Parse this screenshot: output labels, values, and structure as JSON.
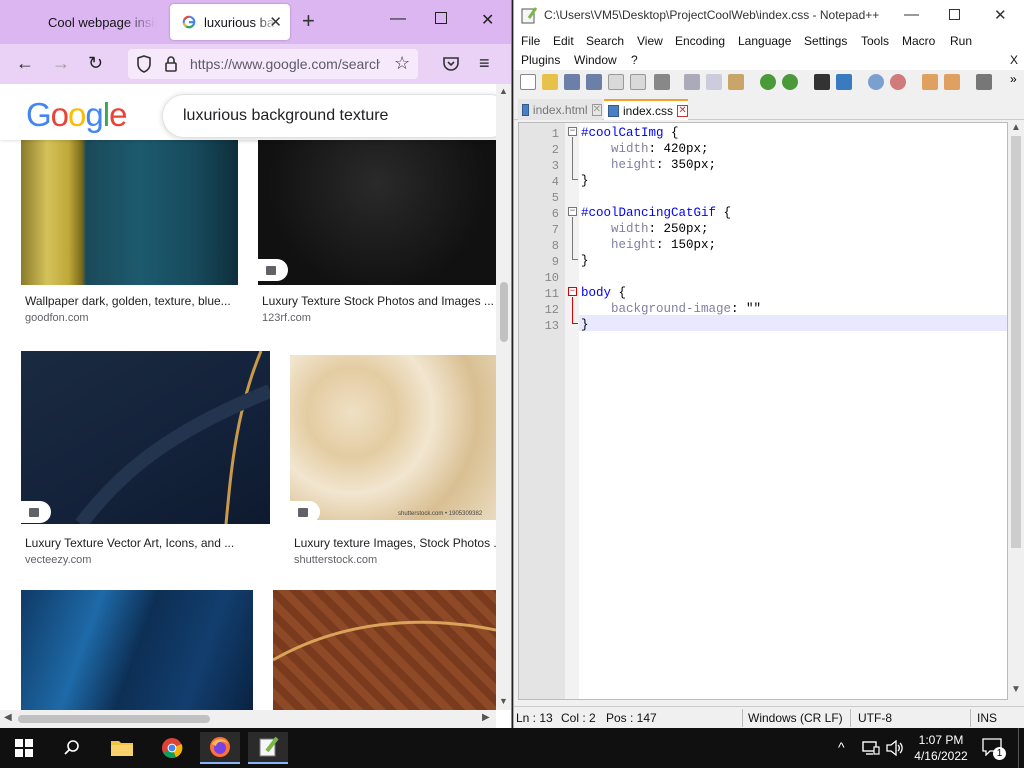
{
  "firefox": {
    "tabs": [
      {
        "label": "Cool webpage insid",
        "active": false
      },
      {
        "label": "luxurious ba",
        "active": true
      }
    ],
    "url": "https://www.google.com/search",
    "search_query": "luxurious background texture",
    "logo": "Google",
    "results": [
      {
        "title": "Wallpaper dark, golden, texture, blue...",
        "source": "goodfon.com"
      },
      {
        "title": "Luxury Texture Stock Photos and Images ...",
        "source": "123rf.com"
      },
      {
        "title": "Luxury Texture Vector Art, Icons, and ...",
        "source": "vecteezy.com"
      },
      {
        "title": "Luxury texture Images, Stock Photos ...",
        "source": "shutterstock.com"
      }
    ],
    "watermark": "shutterstock.com • 1905309382"
  },
  "notepad": {
    "title": "C:\\Users\\VM5\\Desktop\\ProjectCoolWeb\\index.css - Notepad++",
    "menu": [
      "File",
      "Edit",
      "Search",
      "View",
      "Encoding",
      "Language",
      "Settings",
      "Tools",
      "Macro",
      "Run",
      "Plugins",
      "Window",
      "?"
    ],
    "menu_close": "X",
    "tabs": [
      {
        "label": "index.html",
        "active": false
      },
      {
        "label": "index.css",
        "active": true
      }
    ],
    "line_numbers": [
      "1",
      "2",
      "3",
      "4",
      "5",
      "6",
      "7",
      "8",
      "9",
      "10",
      "11",
      "12",
      "13"
    ],
    "code": [
      {
        "sel": "#coolCatImg",
        "rest": " {"
      },
      {
        "prop": "    width",
        "val": ": 420px;"
      },
      {
        "prop": "    height",
        "val": ": 350px;"
      },
      {
        "sel": "",
        "rest": "}"
      },
      {
        "sel": "",
        "rest": ""
      },
      {
        "sel": "#coolDancingCatGif",
        "rest": " {"
      },
      {
        "prop": "    width",
        "val": ": 250px;"
      },
      {
        "prop": "    height",
        "val": ": 150px;"
      },
      {
        "sel": "",
        "rest": "}"
      },
      {
        "sel": "",
        "rest": ""
      },
      {
        "sel": "body",
        "rest": " {"
      },
      {
        "prop": "    background-image",
        "val": ": \"\""
      },
      {
        "sel": "",
        "rest": "}"
      }
    ],
    "status": {
      "ln": "Ln : 13",
      "col": "Col : 2",
      "pos": "Pos : 147",
      "eol": "Windows (CR LF)",
      "encoding": "UTF-8",
      "mode": "INS"
    }
  },
  "taskbar": {
    "time": "1:07 PM",
    "date": "4/16/2022",
    "notification_count": "1"
  }
}
